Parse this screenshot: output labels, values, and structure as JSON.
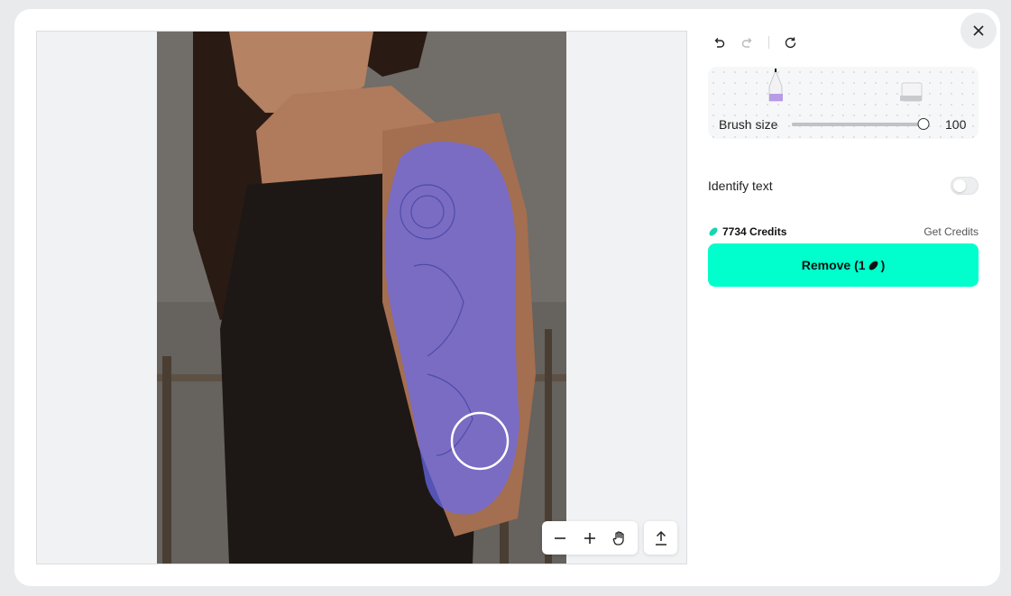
{
  "toolbar": {
    "undo_icon": "undo-icon",
    "redo_icon": "redo-icon",
    "reset_icon": "reset-icon",
    "close_icon": "close-icon"
  },
  "brush": {
    "label": "Brush size",
    "value": "100",
    "slider_fraction": 1.0
  },
  "identify_text": {
    "label": "Identify text",
    "enabled": false
  },
  "credits": {
    "count_text": "7734 Credits",
    "get_label": "Get Credits"
  },
  "remove_button": {
    "label_prefix": "Remove (1",
    "label_suffix": ")"
  },
  "colors": {
    "accent": "#00ffcc",
    "mask": "#6a6cf0",
    "credit_icon": "#16d6b0"
  }
}
